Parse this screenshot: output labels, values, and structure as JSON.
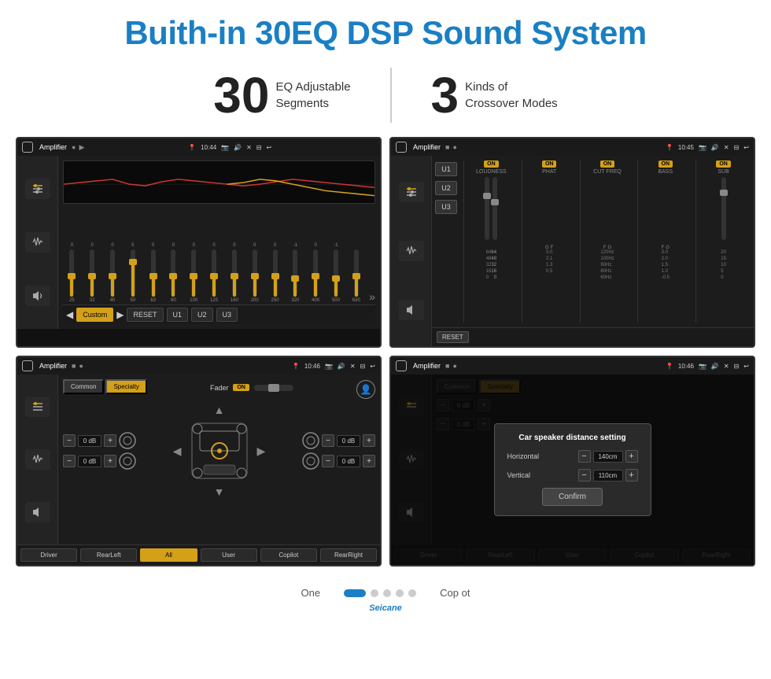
{
  "header": {
    "title": "Buith-in 30EQ DSP Sound System"
  },
  "stats": [
    {
      "number": "30",
      "desc_line1": "EQ Adjustable",
      "desc_line2": "Segments"
    },
    {
      "number": "3",
      "desc_line1": "Kinds of",
      "desc_line2": "Crossover Modes"
    }
  ],
  "screen1": {
    "title": "Amplifier",
    "time": "10:44",
    "freqs": [
      "25",
      "32",
      "40",
      "50",
      "63",
      "80",
      "100",
      "125",
      "160",
      "200",
      "250",
      "320",
      "400",
      "500",
      "630"
    ],
    "values": [
      "0",
      "0",
      "0",
      "5",
      "0",
      "0",
      "0",
      "0",
      "0",
      "0",
      "0",
      "-1",
      "0",
      "-1",
      ""
    ],
    "buttons": [
      "Custom",
      "RESET",
      "U1",
      "U2",
      "U3"
    ]
  },
  "screen2": {
    "title": "Amplifier",
    "time": "10:45",
    "u_buttons": [
      "U1",
      "U2",
      "U3"
    ],
    "columns": [
      {
        "on": true,
        "label": "LOUDNESS"
      },
      {
        "on": true,
        "label": "PHAT"
      },
      {
        "on": true,
        "label": "CUT FREQ"
      },
      {
        "on": true,
        "label": "BASS"
      },
      {
        "on": true,
        "label": "SUB"
      }
    ],
    "reset": "RESET"
  },
  "screen3": {
    "title": "Amplifier",
    "time": "10:46",
    "tabs": [
      "Common",
      "Specialty"
    ],
    "active_tab": "Specialty",
    "fader_label": "Fader",
    "fader_on": "ON",
    "controls": [
      {
        "value": "0 dB"
      },
      {
        "value": "0 dB"
      },
      {
        "value": "0 dB"
      },
      {
        "value": "0 dB"
      }
    ],
    "bottom_buttons": [
      "Driver",
      "RearLeft",
      "All",
      "User",
      "Copilot",
      "RearRight"
    ]
  },
  "screen4": {
    "title": "Amplifier",
    "time": "10:46",
    "tabs": [
      "Common",
      "Specialty"
    ],
    "active_tab": "Specialty",
    "dialog": {
      "title": "Car speaker distance setting",
      "horizontal_label": "Horizontal",
      "horizontal_value": "140cm",
      "vertical_label": "Vertical",
      "vertical_value": "110cm",
      "confirm_label": "Confirm"
    },
    "controls": [
      {
        "value": "0 dB"
      },
      {
        "value": "0 dB"
      }
    ],
    "bottom_buttons": [
      "Driver",
      "RearLeft",
      "User",
      "Copilot",
      "RearRight"
    ]
  },
  "pagination": {
    "label1": "One",
    "label2": "Cop ot"
  },
  "watermark": "Seicane"
}
